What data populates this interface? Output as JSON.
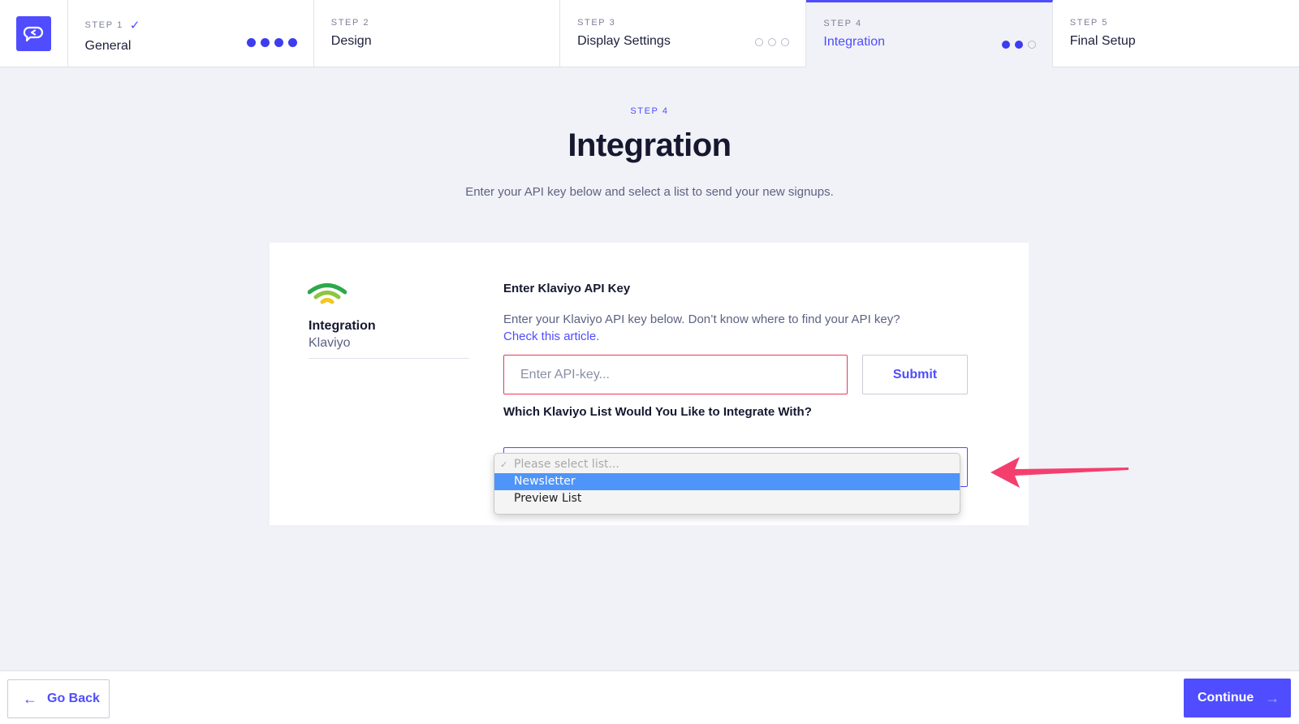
{
  "colors": {
    "accent": "#4f4dff",
    "error": "#e73a5b",
    "page_bg": "#f1f2f7",
    "annotation": "#f43f6e",
    "highlight": "#4f94f8"
  },
  "logo": {
    "icon": "chat-bubble-logo-icon"
  },
  "steps": [
    {
      "label": "STEP 1",
      "title": "General",
      "completed": true,
      "check_icon": "checkmark-icon",
      "progress": "4 of 4"
    },
    {
      "label": "STEP 2",
      "title": "Design"
    },
    {
      "label": "STEP 3",
      "title": "Display Settings",
      "progress": "0 of 3"
    },
    {
      "label": "STEP 4",
      "title": "Integration",
      "active": true,
      "progress": "2 of 3"
    },
    {
      "label": "STEP 5",
      "title": "Final Setup"
    }
  ],
  "header": {
    "kicker": "STEP 4",
    "title": "Integration",
    "subtitle": "Enter your API key below and select a list to send your new signups."
  },
  "integration": {
    "icon": "klaviyo-signal-icon",
    "title": "Integration",
    "provider": "Klaviyo"
  },
  "api": {
    "label": "Enter Klaviyo API Key",
    "help_text": "Enter your Klaviyo API key below. Don’t know where to find your API key?",
    "help_link": "Check this article.",
    "input_value": "",
    "input_placeholder": "Enter API-key...",
    "submit_label": "Submit"
  },
  "list_select": {
    "label": "Which Klaviyo List Would You Like to Integrate With?",
    "options": [
      "Please select list...",
      "Newsletter",
      "Preview List"
    ],
    "highlighted": "Newsletter",
    "checked": "Please select list..."
  },
  "annotation": {
    "icon": "pink-arrow-icon"
  },
  "footer": {
    "back_label": "Go Back",
    "back_icon": "arrow-left-icon",
    "continue_label": "Continue",
    "continue_icon": "arrow-right-icon"
  }
}
